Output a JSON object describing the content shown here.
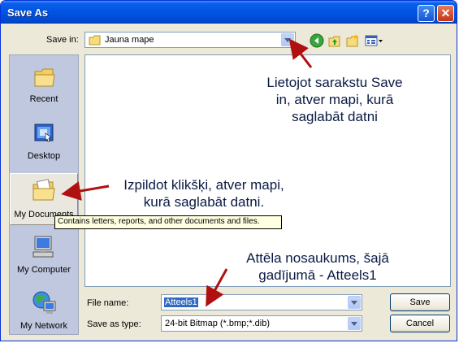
{
  "window": {
    "title": "Save As"
  },
  "toolbar": {
    "save_in_label": "Save in:",
    "save_in_value": "Jauna mape"
  },
  "places": [
    {
      "label": "Recent"
    },
    {
      "label": "Desktop"
    },
    {
      "label": "My Documents"
    },
    {
      "label": "My Computer"
    },
    {
      "label": "My Network"
    }
  ],
  "tooltip": "Contains letters, reports, and other documents and files.",
  "form": {
    "filename_label": "File name:",
    "filename_value": "Atteels1",
    "type_label": "Save as type:",
    "type_value": "24-bit Bitmap (*.bmp;*.dib)"
  },
  "buttons": {
    "save": "Save",
    "cancel": "Cancel"
  },
  "annotations": {
    "save_in_line1": "Lietojot sarakstu Save",
    "save_in_line2": "in, atver mapi, kurā",
    "save_in_line3": "saglabāt datni",
    "mydocs_line1": "Izpildot klikšķi, atver mapi,",
    "mydocs_line2": "kurā saglabāt datni.",
    "name_line1": "Attēla nosaukums, šajā",
    "name_line2": "gadījumā - Atteels1"
  },
  "colors": {
    "annotation_arrow": "#b01010",
    "titlebar": "#0054e3"
  }
}
